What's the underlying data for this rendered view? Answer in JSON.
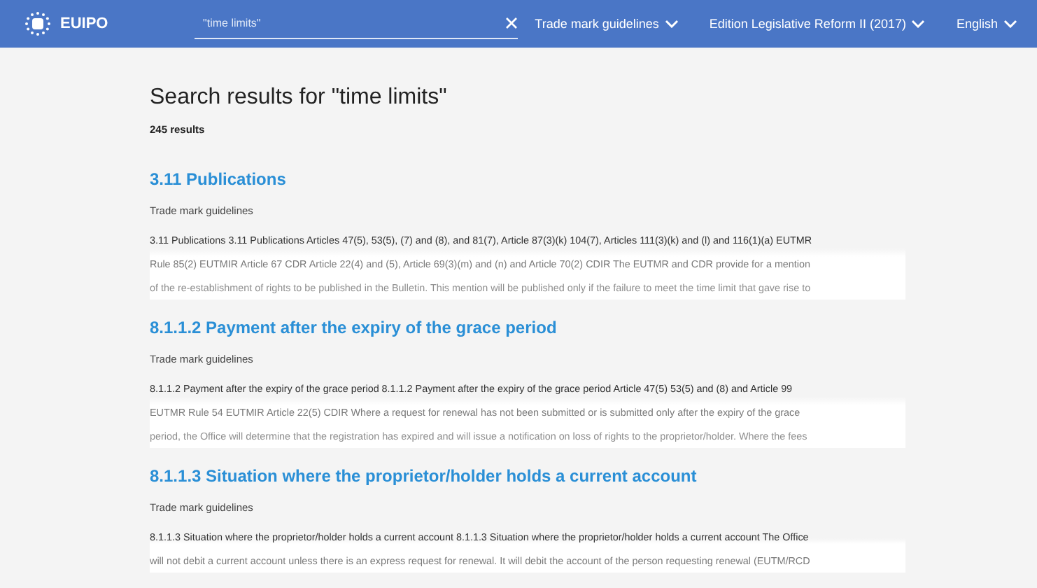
{
  "header": {
    "logo": "EUIPO",
    "search": {
      "value": "\"time limits\""
    },
    "menus": [
      "Trade mark guidelines",
      "Edition Legislative Reform II (2017)",
      "English"
    ]
  },
  "title": "Search results for \"time limits\"",
  "count": "245 results",
  "results": [
    {
      "title": "3.11 Publications",
      "source": "Trade mark guidelines",
      "lines": [
        "3.11 Publications 3.11 Publications Articles 47(5), 53(5), (7) and (8), and 81(7), Article 87(3)(k) 104(7), Articles 111(3)(k) and (l) and 116(1)(a) EUTMR",
        "Rule 85(2) EUTMIR Article 67 CDR Article 22(4) and (5), Article 69(3)(m) and (n) and Article 70(2) CDIR The EUTMR and CDR provide for a mention",
        "of the re-establishment of rights to be published in the Bulletin. This mention will be published only if the failure to meet the time limit that gave rise to"
      ]
    },
    {
      "title": "8.1.1.2 Payment after the expiry of the grace period",
      "source": "Trade mark guidelines",
      "lines": [
        "8.1.1.2 Payment after the expiry of the grace period 8.1.1.2 Payment after the expiry of the grace period Article 47(5) 53(5) and (8) and Article 99",
        "EUTMR Rule 54 EUTMIR Article 22(5) CDIR Where a request for renewal has not been submitted or is submitted only after the expiry of the grace",
        "period, the Office will determine that the registration has expired and will issue a notification on loss of rights to the proprietor/holder. Where the fees"
      ]
    },
    {
      "title": "8.1.1.3 Situation where the proprietor/holder holds a current account",
      "source": "Trade mark guidelines",
      "lines": [
        "8.1.1.3 Situation where the proprietor/holder holds a current account 8.1.1.3 Situation where the proprietor/holder holds a current account The Office",
        "will not debit a current account unless there is an express request for renewal. It will debit the account of the person requesting renewal (EUTM/RCD"
      ]
    }
  ]
}
